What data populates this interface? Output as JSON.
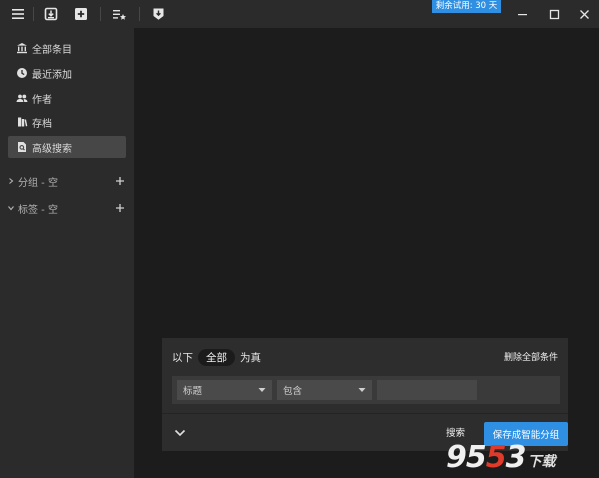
{
  "window": {
    "trial_badge": "剩余试用: 30 天"
  },
  "sidebar": {
    "items": [
      {
        "label": "全部条目",
        "icon": "bank-icon"
      },
      {
        "label": "最近添加",
        "icon": "clock-icon"
      },
      {
        "label": "作者",
        "icon": "people-icon"
      },
      {
        "label": "存档",
        "icon": "archive-icon"
      },
      {
        "label": "高级搜索",
        "icon": "search-doc-icon",
        "active": true
      }
    ],
    "sections": [
      {
        "label": "分组 - 空",
        "expanded": false
      },
      {
        "label": "标签 - 空",
        "expanded": true
      }
    ]
  },
  "search_panel": {
    "prefix": "以下",
    "match_mode": "全部",
    "suffix": "为真",
    "delete_all_label": "删除全部条件",
    "rule": {
      "field": "标题",
      "operator": "包含",
      "value": ""
    },
    "search_label": "搜索",
    "save_label": "保存成智能分组"
  },
  "watermark": {
    "number_a": "95",
    "number_b": "5",
    "number_c": "3",
    "suffix": "下载"
  },
  "colors": {
    "accent": "#2f8fe2",
    "sidebar_bg": "#2b2b2b",
    "main_bg": "#1c1c1c",
    "active_item": "#474747"
  }
}
